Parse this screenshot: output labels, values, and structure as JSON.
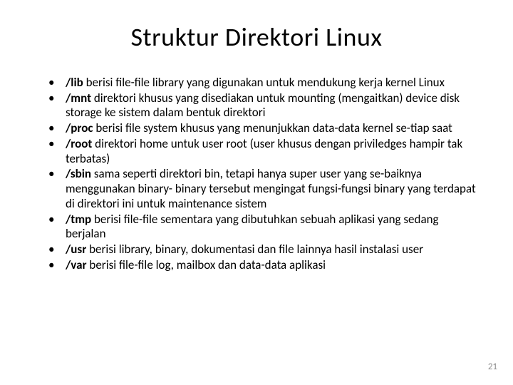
{
  "title": "Struktur Direktori Linux",
  "items": [
    {
      "bold": "/lib",
      "text": " berisi file-file library yang digunakan untuk mendukung kerja kernel Linux"
    },
    {
      "bold": "/mnt",
      "text": " direktori khusus yang disediakan untuk mounting (mengaitkan) device disk storage ke sistem dalam bentuk direktori"
    },
    {
      "bold": "/proc",
      "text": " berisi file system khusus yang menunjukkan data-data kernel se-tiap saat"
    },
    {
      "bold": "/root",
      "text": " direktori home untuk user root (user khusus dengan priviledges hampir tak terbatas)"
    },
    {
      "bold": "/sbin",
      "text": " sama seperti direktori bin, tetapi hanya super user yang se-baiknya menggunakan binary- binary tersebut mengingat fungsi-fungsi binary yang terdapat di direktori ini untuk maintenance sistem"
    },
    {
      "bold": "/tmp",
      "text": " berisi file-file sementara yang dibutuhkan sebuah aplikasi yang sedang berjalan"
    },
    {
      "bold": "/usr",
      "text": " berisi library, binary, dokumentasi dan file lainnya hasil instalasi user"
    },
    {
      "bold": "/var",
      "text": " berisi file-file log, mailbox dan data-data aplikasi"
    }
  ],
  "pageNumber": "21"
}
